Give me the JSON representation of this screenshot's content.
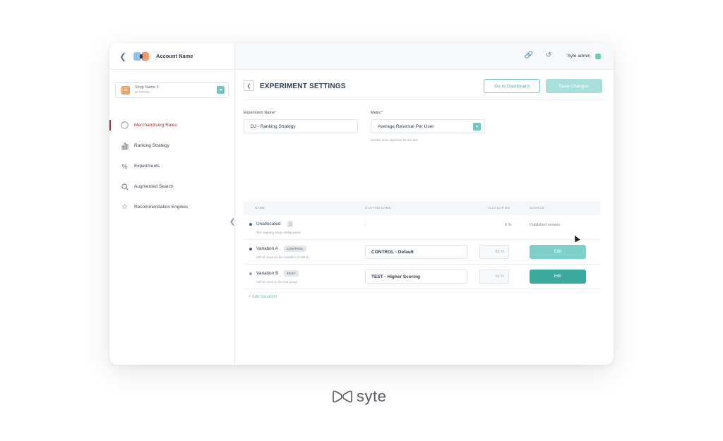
{
  "sidebar": {
    "account_name": "Account Name",
    "shop": {
      "name": "Shop Name 3",
      "id": "ID 247432"
    },
    "items": [
      {
        "label": "Merchandising Rules",
        "icon": "rules-icon",
        "active": true
      },
      {
        "label": "Ranking Strategy",
        "icon": "bar-chart-icon",
        "active": false
      },
      {
        "label": "Experiments",
        "icon": "percent-icon",
        "active": false
      },
      {
        "label": "Augmented Search",
        "icon": "search-icon",
        "active": false
      },
      {
        "label": "Recommendation Engines",
        "icon": "star-icon",
        "active": false
      }
    ]
  },
  "topbar": {
    "user": "Syte admin"
  },
  "main": {
    "title": "EXPERIMENT SETTINGS",
    "go_dashboard": "Go to Dashboard",
    "save_changes": "Save Changes",
    "experiment_name_label": "Experiment Name",
    "experiment_name_value": "DJ - Ranking Strategy",
    "metric_label": "Metric",
    "metric_value": "Average Revenue Per User",
    "metric_hint": "Set the main objective for the test",
    "table": {
      "headers": {
        "name": "NAME",
        "custom_name": "CUSTOM NAME",
        "allocation": "ALLOCATION",
        "source": "SOURCE"
      },
      "rows": [
        {
          "name": "Unallocated",
          "desc": "The ongoing shop configuration",
          "custom": "-",
          "allocation": "0 %",
          "source": "Published version",
          "dot": "#4a5b9c"
        },
        {
          "name": "Variation A",
          "tag": "CONTROL",
          "desc": "Will be used as the baseline (Control)",
          "custom": "CONTROL - Default",
          "allocation": "50 %",
          "source": "Edit",
          "dot": "#4a5b9c"
        },
        {
          "name": "Variation B",
          "tag": "TEST",
          "desc": "Will be used in the test group",
          "custom": "TEST - Higher Scoring",
          "allocation": "50 %",
          "source": "Edit",
          "dot": "#b490c9"
        }
      ]
    },
    "add_variation": "+ Add Variation"
  },
  "brand": {
    "wordmark": "syte"
  },
  "colors": {
    "accent": "#73c6c0",
    "accent_dark": "#3aa99f",
    "active_nav": "#a0303a"
  }
}
